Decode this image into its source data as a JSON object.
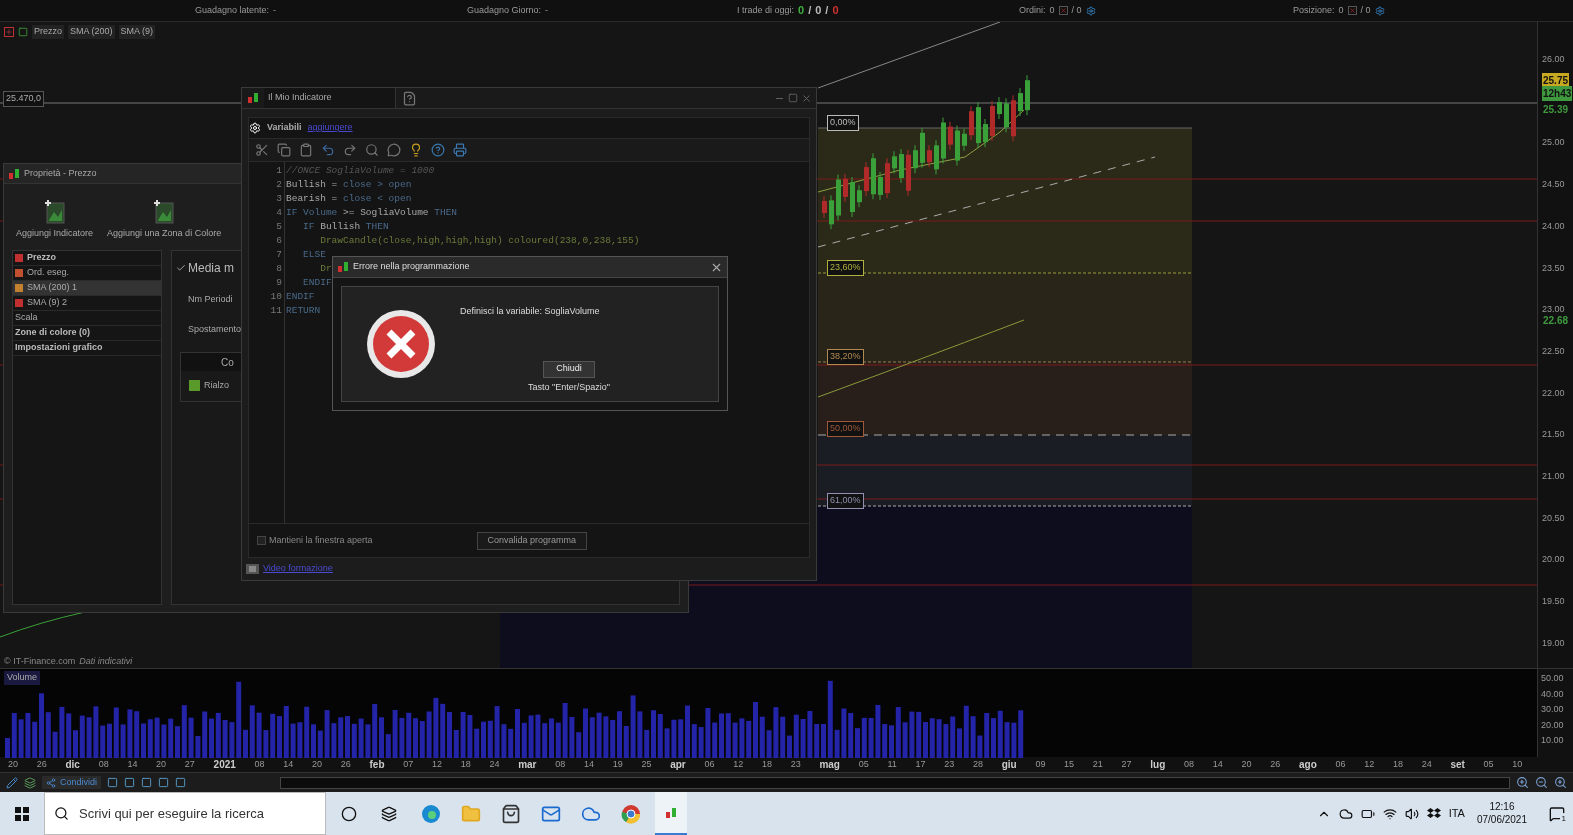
{
  "status_bar": [
    {
      "kind": "text",
      "label": "Guadagno latente:",
      "value": "-"
    },
    {
      "kind": "text",
      "label": "Guadagno Giorno:",
      "value": "-"
    },
    {
      "kind": "trades",
      "label": "I trade di oggi:",
      "parts": [
        {
          "text": "0",
          "color": "#3fae3f"
        },
        {
          "text": "/",
          "color": "#bbbbbb"
        },
        {
          "text": "0",
          "color": "#bbbbbb"
        },
        {
          "text": "/",
          "color": "#bbbbbb"
        },
        {
          "text": "0",
          "color": "#d03030"
        }
      ]
    },
    {
      "kind": "orders",
      "label": "Ordini:",
      "value": "0",
      "rest": "/ 0"
    },
    {
      "kind": "orders",
      "label": "Posizione:",
      "value": "0",
      "rest": "/ 0"
    }
  ],
  "legend": [
    "Prezzo",
    "SMA (200)",
    "SMA (9)"
  ],
  "price_tag": "25.470,0",
  "fib_levels": [
    {
      "label": "0,00%",
      "color": "#bbbbbb"
    },
    {
      "label": "23,60%",
      "color": "#b0b040"
    },
    {
      "label": "38,20%",
      "color": "#b08a50"
    },
    {
      "label": "50,00%",
      "color": "#a05a3a"
    },
    {
      "label": "61,00%",
      "color": "#9090b0"
    }
  ],
  "price_axis": [
    "26.00",
    "25.00",
    "24.50",
    "24.00",
    "23.50",
    "23.00",
    "22.50",
    "22.00",
    "21.50",
    "21.00",
    "20.50",
    "20.00",
    "19.50",
    "19.00"
  ],
  "price_tags": [
    {
      "text": "25.75",
      "kind": "fill",
      "color": "#c8a820"
    },
    {
      "text": "12h43",
      "kind": "fill",
      "color": "#3f9a3f"
    },
    {
      "text": "25.39",
      "kind": "plain",
      "color": "#3f9a3f"
    },
    {
      "text": "22.68",
      "kind": "plain",
      "color": "#3f9a3f"
    }
  ],
  "credit": {
    "source": "© IT-Finance.com",
    "note": "Dati indicativi"
  },
  "volume": {
    "legend": "Volume",
    "axis": [
      "50.00",
      "40.00",
      "30.00",
      "20.00",
      "10.00"
    ]
  },
  "date_axis": [
    {
      "text": "20",
      "kind": "day"
    },
    {
      "text": "26",
      "kind": "day"
    },
    {
      "text": "dic",
      "kind": "month"
    },
    {
      "text": "08",
      "kind": "day"
    },
    {
      "text": "14",
      "kind": "day"
    },
    {
      "text": "20",
      "kind": "day"
    },
    {
      "text": "27",
      "kind": "day"
    },
    {
      "text": "2021",
      "kind": "month"
    },
    {
      "text": "08",
      "kind": "day"
    },
    {
      "text": "14",
      "kind": "day"
    },
    {
      "text": "20",
      "kind": "day"
    },
    {
      "text": "26",
      "kind": "day"
    },
    {
      "text": "feb",
      "kind": "month"
    },
    {
      "text": "07",
      "kind": "day"
    },
    {
      "text": "12",
      "kind": "day"
    },
    {
      "text": "18",
      "kind": "day"
    },
    {
      "text": "24",
      "kind": "day"
    },
    {
      "text": "mar",
      "kind": "month"
    },
    {
      "text": "08",
      "kind": "day"
    },
    {
      "text": "14",
      "kind": "day"
    },
    {
      "text": "19",
      "kind": "day"
    },
    {
      "text": "25",
      "kind": "day"
    },
    {
      "text": "apr",
      "kind": "month"
    },
    {
      "text": "06",
      "kind": "day"
    },
    {
      "text": "12",
      "kind": "day"
    },
    {
      "text": "18",
      "kind": "day"
    },
    {
      "text": "23",
      "kind": "day"
    },
    {
      "text": "mag",
      "kind": "month"
    },
    {
      "text": "05",
      "kind": "day"
    },
    {
      "text": "11",
      "kind": "day"
    },
    {
      "text": "17",
      "kind": "day"
    },
    {
      "text": "23",
      "kind": "day"
    },
    {
      "text": "28",
      "kind": "day"
    },
    {
      "text": "giu",
      "kind": "month"
    },
    {
      "text": "09",
      "kind": "day"
    },
    {
      "text": "15",
      "kind": "day"
    },
    {
      "text": "21",
      "kind": "day"
    },
    {
      "text": "27",
      "kind": "day"
    },
    {
      "text": "lug",
      "kind": "month"
    },
    {
      "text": "08",
      "kind": "day"
    },
    {
      "text": "14",
      "kind": "day"
    },
    {
      "text": "20",
      "kind": "day"
    },
    {
      "text": "26",
      "kind": "day"
    },
    {
      "text": "ago",
      "kind": "month"
    },
    {
      "text": "06",
      "kind": "day"
    },
    {
      "text": "12",
      "kind": "day"
    },
    {
      "text": "18",
      "kind": "day"
    },
    {
      "text": "24",
      "kind": "day"
    },
    {
      "text": "set",
      "kind": "month"
    },
    {
      "text": "05",
      "kind": "day"
    },
    {
      "text": "10",
      "kind": "day"
    }
  ],
  "toolbar": {
    "share": "Condividi"
  },
  "properties_window": {
    "title": "Proprietà - Prezzo",
    "actions": [
      "Aggiungi Indicatore",
      "Aggiungi una Zona di Colore"
    ],
    "tree": [
      {
        "label": "Prezzo",
        "color": "#c03030",
        "bold": true,
        "selected": false
      },
      {
        "label": "Ord. eseg.",
        "color": "#c05030",
        "bold": false,
        "selected": false
      },
      {
        "label": "SMA (200) 1",
        "color": "#c08030",
        "bold": false,
        "selected": true
      },
      {
        "label": "SMA (9) 2",
        "color": "#c03030",
        "bold": false,
        "selected": false
      },
      {
        "label": "Scala",
        "bold": false,
        "selected": false
      },
      {
        "label": "Zone di colore (0)",
        "bold": true,
        "selected": false
      },
      {
        "label": "Impostazioni grafico",
        "bold": true,
        "selected": false
      }
    ],
    "panel": {
      "title": "Media m",
      "checked": true,
      "fields": [
        "Nm Periodi",
        "Spostamento"
      ],
      "table_header": "Co",
      "row": {
        "label": "Rialzo",
        "color": "#5a9a2a"
      }
    }
  },
  "editor_window": {
    "title": "Il Mio Indicatore",
    "variables": "Variabili",
    "add_link": "aggiungere",
    "code": [
      {
        "number": "1",
        "tokens": [
          {
            "text": "//ONCE SogliaVolume = 1000",
            "kind": "comment"
          }
        ]
      },
      {
        "number": "2",
        "tokens": [
          {
            "text": "Bullish = ",
            "kind": "plain"
          },
          {
            "text": "close > open",
            "kind": "keyword"
          }
        ]
      },
      {
        "number": "3",
        "tokens": [
          {
            "text": "Bearish = ",
            "kind": "plain"
          },
          {
            "text": "close < open",
            "kind": "keyword"
          }
        ]
      },
      {
        "number": "4",
        "tokens": [
          {
            "text": "IF ",
            "kind": "keyword"
          },
          {
            "text": "Volume",
            "kind": "keyword"
          },
          {
            "text": " >= SogliaVolume ",
            "kind": "plain"
          },
          {
            "text": "THEN",
            "kind": "keyword"
          }
        ]
      },
      {
        "number": "5",
        "tokens": [
          {
            "text": "   IF ",
            "kind": "keyword"
          },
          {
            "text": "Bullish ",
            "kind": "plain"
          },
          {
            "text": "THEN",
            "kind": "keyword"
          }
        ]
      },
      {
        "number": "6",
        "tokens": [
          {
            "text": "      DrawCandle(close,high,high,high) coloured(238,0,238,155)",
            "kind": "function"
          }
        ]
      },
      {
        "number": "7",
        "tokens": [
          {
            "text": "   ELSE",
            "kind": "keyword"
          }
        ]
      },
      {
        "number": "8",
        "tokens": [
          {
            "text": "      Dr",
            "kind": "function"
          }
        ]
      },
      {
        "number": "9",
        "tokens": [
          {
            "text": "   ENDIF",
            "kind": "keyword"
          }
        ]
      },
      {
        "number": "10",
        "tokens": [
          {
            "text": "ENDIF",
            "kind": "keyword"
          }
        ]
      },
      {
        "number": "11",
        "tokens": [
          {
            "text": "RETURN",
            "kind": "keyword"
          }
        ]
      }
    ],
    "keep_open": {
      "label": "Mantieni la finestra aperta",
      "checked": false
    },
    "validate": "Convalida programma",
    "video_link": "Video formazione"
  },
  "error_dialog": {
    "title": "Errore nella programmazione",
    "message": "Definisci la variabile: SogliaVolume",
    "button": "Chiudi",
    "hint": "Tasto \"Enter/Spazio\""
  },
  "taskbar": {
    "search_placeholder": "Scrivi qui per eseguire la ricerca",
    "language": "ITA",
    "time": "12:16",
    "date": "07/06/2021",
    "notifications": "1"
  }
}
